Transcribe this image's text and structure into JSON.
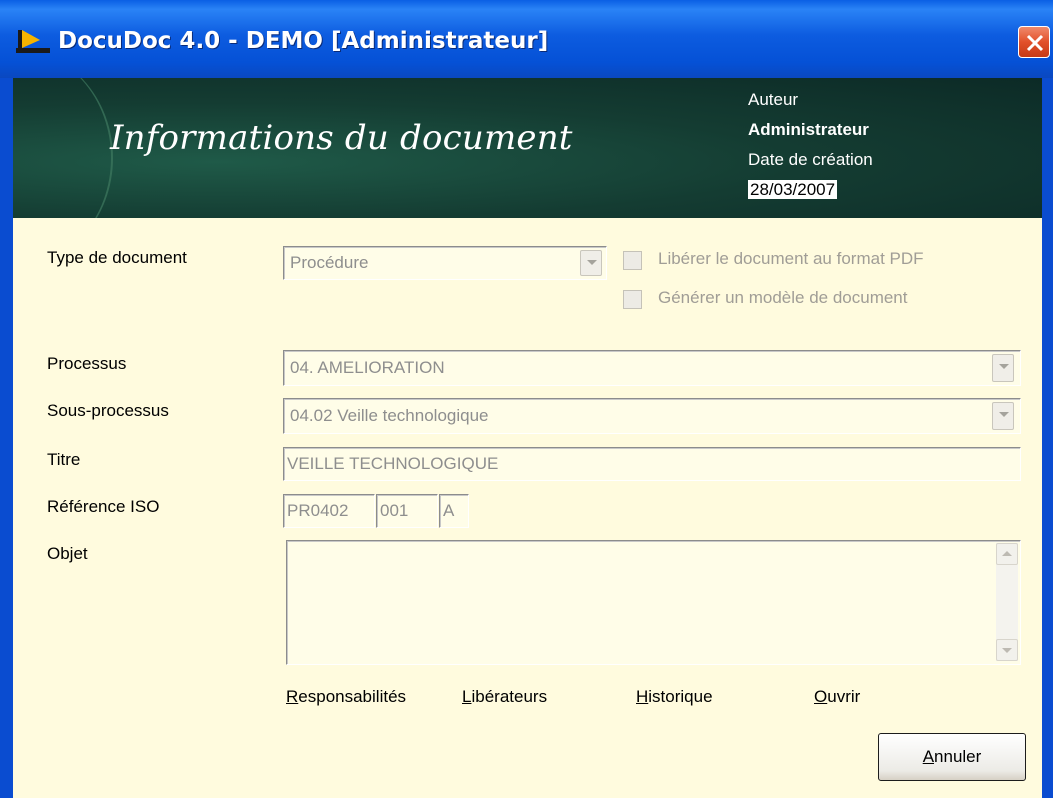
{
  "window": {
    "title": "DocuDoc 4.0 - DEMO [Administrateur]"
  },
  "header": {
    "title": "Informations du document",
    "author_label": "Auteur",
    "author_value": "Administrateur",
    "date_label": "Date de création",
    "date_value": "28/03/2007"
  },
  "form": {
    "type_label": "Type de document",
    "type_value": "Procédure",
    "checkbox_pdf_label": "Libérer le document au format PDF",
    "checkbox_template_label": "Générer un modèle de document",
    "processus_label": "Processus",
    "processus_value": "04. AMELIORATION",
    "sousprocessus_label": "Sous-processus",
    "sousprocessus_value": "04.02 Veille technologique",
    "titre_label": "Titre",
    "titre_value": "VEILLE TECHNOLOGIQUE",
    "ref_label": "Référence ISO",
    "ref_part1": "PR0402",
    "ref_part2": "001",
    "ref_part3": "A",
    "objet_label": "Objet",
    "objet_value": ""
  },
  "links": {
    "responsabilites_first": "R",
    "responsabilites_rest": "esponsabilités",
    "liberateurs_first": "L",
    "liberateurs_rest": "ibérateurs",
    "historique_first": "H",
    "historique_rest": "istorique",
    "ouvrir_first": "O",
    "ouvrir_rest": "uvrir"
  },
  "buttons": {
    "annuler_first": "A",
    "annuler_rest": "nnuler"
  },
  "icons": [
    "app-logo-icon",
    "close-icon",
    "dropdown-arrow-icon",
    "scroll-up-icon",
    "scroll-down-icon"
  ]
}
